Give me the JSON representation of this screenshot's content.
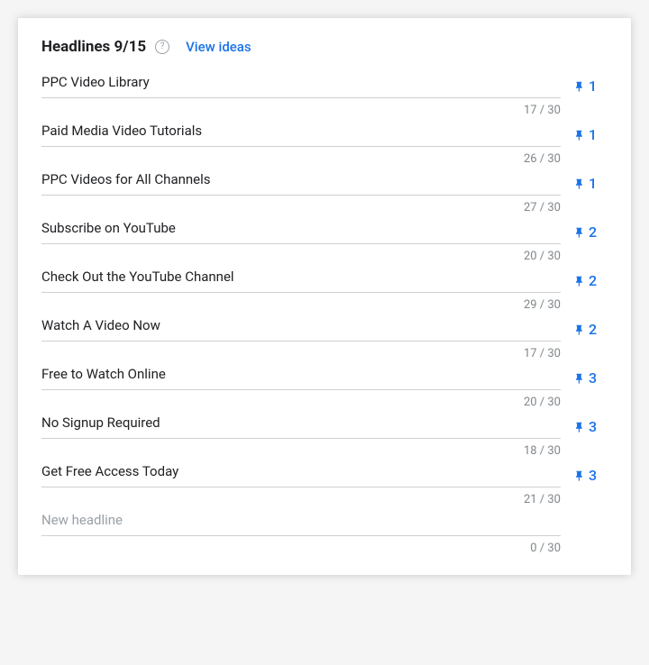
{
  "header": {
    "title": "Headlines 9/15",
    "help": "?",
    "view_ideas": "View ideas"
  },
  "max_chars": 30,
  "headlines": [
    {
      "text": "PPC Video Library",
      "chars": 17,
      "pin": 1
    },
    {
      "text": "Paid Media Video Tutorials",
      "chars": 26,
      "pin": 1
    },
    {
      "text": "PPC Videos for All Channels",
      "chars": 27,
      "pin": 1
    },
    {
      "text": "Subscribe on YouTube",
      "chars": 20,
      "pin": 2
    },
    {
      "text": "Check Out the YouTube Channel",
      "chars": 29,
      "pin": 2
    },
    {
      "text": "Watch A Video Now",
      "chars": 17,
      "pin": 2
    },
    {
      "text": "Free to Watch Online",
      "chars": 20,
      "pin": 3
    },
    {
      "text": "No Signup Required",
      "chars": 18,
      "pin": 3
    },
    {
      "text": "Get Free Access Today",
      "chars": 21,
      "pin": 3
    }
  ],
  "empty_slot": {
    "placeholder": "New headline",
    "chars": 0
  }
}
